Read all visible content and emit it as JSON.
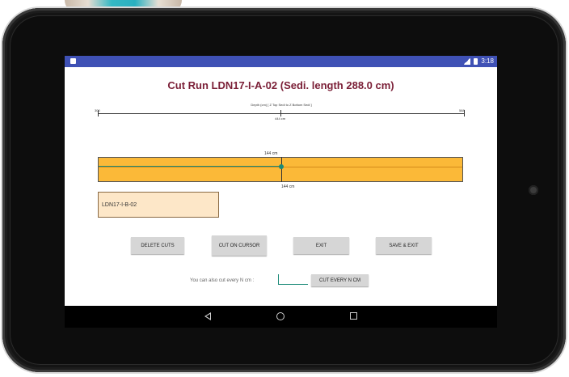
{
  "status_bar": {
    "time": "3:18"
  },
  "app": {
    "title": "Cut Run LDN17-I-A-02 (Sedi. length 288.0 cm)"
  },
  "ruler": {
    "caption": "Depth (cm) [ Z Top Sedi to Z Bottom Sedi ]",
    "start_label": "300",
    "mid_label": "444 cm",
    "end_label": "588"
  },
  "core": {
    "cursor_label_top": "144 cm",
    "cursor_label_bottom": "144 cm",
    "cursor_fraction": 0.5
  },
  "section": {
    "label": "LDN17-I-B-02"
  },
  "buttons": {
    "delete_cuts": "DELETE CUTS",
    "cut_on_cursor": "CUT ON CURSOR",
    "exit": "EXIT",
    "save_exit": "SAVE & EXIT",
    "cut_every_n_cm": "CUT EVERY N CM"
  },
  "cut_every": {
    "prompt": "You can also cut every N cm :",
    "value": ""
  },
  "colors": {
    "status_bar": "#3f51b5",
    "title": "#7a1e36",
    "core_fill": "#fbb938",
    "cursor": "#1b8a78",
    "section_fill": "#fde7c8",
    "button": "#d6d6d6"
  }
}
